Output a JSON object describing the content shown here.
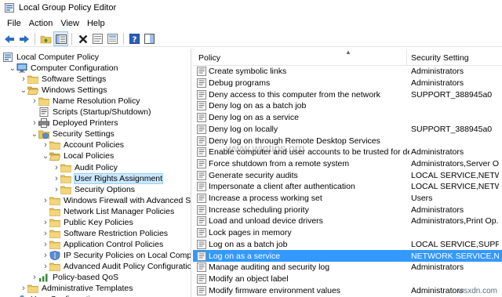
{
  "window": {
    "title": "Local Group Policy Editor"
  },
  "menu": [
    "File",
    "Action",
    "View",
    "Help"
  ],
  "toolbar": [
    "back-arrow-icon",
    "forward-arrow-icon",
    "up-folder-icon",
    "show-hide-tree-icon",
    "delete-icon",
    "properties-icon",
    "export-list-icon",
    "help-icon",
    "show-pane-icon"
  ],
  "tree": [
    {
      "label": "Local Computer Policy",
      "level": 0,
      "expander": "",
      "icon": "computer-policy-icon"
    },
    {
      "label": "Computer Configuration",
      "level": 1,
      "expander": "open",
      "icon": "computer-config-icon"
    },
    {
      "label": "Software Settings",
      "level": 2,
      "expander": "closed",
      "icon": "folder-icon"
    },
    {
      "label": "Windows Settings",
      "level": 2,
      "expander": "open",
      "icon": "folder-open-icon"
    },
    {
      "label": "Name Resolution Policy",
      "level": 3,
      "expander": "closed",
      "icon": "folder-icon"
    },
    {
      "label": "Scripts (Startup/Shutdown)",
      "level": 3,
      "expander": "",
      "icon": "scripts-icon"
    },
    {
      "label": "Deployed Printers",
      "level": 3,
      "expander": "closed",
      "icon": "printer-icon"
    },
    {
      "label": "Security Settings",
      "level": 3,
      "expander": "open",
      "icon": "security-icon"
    },
    {
      "label": "Account Policies",
      "level": 4,
      "expander": "closed",
      "icon": "folder-icon"
    },
    {
      "label": "Local Policies",
      "level": 4,
      "expander": "open",
      "icon": "folder-open-icon"
    },
    {
      "label": "Audit Policy",
      "level": 5,
      "expander": "closed",
      "icon": "folder-icon"
    },
    {
      "label": "User Rights Assignment",
      "level": 5,
      "expander": "closed",
      "icon": "folder-icon",
      "selected": true
    },
    {
      "label": "Security Options",
      "level": 5,
      "expander": "closed",
      "icon": "folder-icon"
    },
    {
      "label": "Windows Firewall with Advanced Securit",
      "level": 4,
      "expander": "closed",
      "icon": "folder-icon"
    },
    {
      "label": "Network List Manager Policies",
      "level": 4,
      "expander": "",
      "icon": "folder-icon"
    },
    {
      "label": "Public Key Policies",
      "level": 4,
      "expander": "closed",
      "icon": "folder-icon"
    },
    {
      "label": "Software Restriction Policies",
      "level": 4,
      "expander": "closed",
      "icon": "folder-icon"
    },
    {
      "label": "Application Control Policies",
      "level": 4,
      "expander": "closed",
      "icon": "folder-icon"
    },
    {
      "label": "IP Security Policies on Local Computer",
      "level": 4,
      "expander": "closed",
      "icon": "ip-security-icon"
    },
    {
      "label": "Advanced Audit Policy Configuration",
      "level": 4,
      "expander": "closed",
      "icon": "folder-icon"
    },
    {
      "label": "Policy-based QoS",
      "level": 3,
      "expander": "closed",
      "icon": "qos-icon"
    },
    {
      "label": "Administrative Templates",
      "level": 2,
      "expander": "closed",
      "icon": "folder-icon"
    },
    {
      "label": "User Configuration",
      "level": 1,
      "expander": "closed",
      "icon": "user-config-icon"
    }
  ],
  "list": {
    "columns": [
      "Policy",
      "Security Setting"
    ],
    "rows": [
      {
        "policy": "Create symbolic links",
        "setting": "Administrators"
      },
      {
        "policy": "Debug programs",
        "setting": "Administrators"
      },
      {
        "policy": "Deny access to this computer from the network",
        "setting": "SUPPORT_388945a0"
      },
      {
        "policy": "Deny log on as a batch job",
        "setting": ""
      },
      {
        "policy": "Deny log on as a service",
        "setting": ""
      },
      {
        "policy": "Deny log on locally",
        "setting": "SUPPORT_388945a0"
      },
      {
        "policy": "Deny log on through Remote Desktop Services",
        "setting": ""
      },
      {
        "policy": "Enable computer and user accounts to be trusted for delega...",
        "setting": "Administrators"
      },
      {
        "policy": "Force shutdown from a remote system",
        "setting": "Administrators,Server O..."
      },
      {
        "policy": "Generate security audits",
        "setting": "LOCAL SERVICE,NETWO..."
      },
      {
        "policy": "Impersonate a client after authentication",
        "setting": "LOCAL SERVICE,NETWO..."
      },
      {
        "policy": "Increase a process working set",
        "setting": "Users"
      },
      {
        "policy": "Increase scheduling priority",
        "setting": "Administrators"
      },
      {
        "policy": "Load and unload device drivers",
        "setting": "Administrators,Print Op..."
      },
      {
        "policy": "Lock pages in memory",
        "setting": ""
      },
      {
        "policy": "Log on as a batch job",
        "setting": "LOCAL SERVICE,SUPPO..."
      },
      {
        "policy": "Log on as a service",
        "setting": "NETWORK SERVICE,NT ...",
        "selected": true
      },
      {
        "policy": "Manage auditing and security log",
        "setting": "Administrators"
      },
      {
        "policy": "Modify an object label",
        "setting": ""
      },
      {
        "policy": "Modify firmware environment values",
        "setting": "Administrators"
      }
    ]
  },
  "watermark": "www.wintips.org",
  "sitemark": "wsxdn.com",
  "colors": {
    "selection": "#3399ff",
    "tree_selection": "#cce8ff",
    "folder": "#e8c35a"
  }
}
